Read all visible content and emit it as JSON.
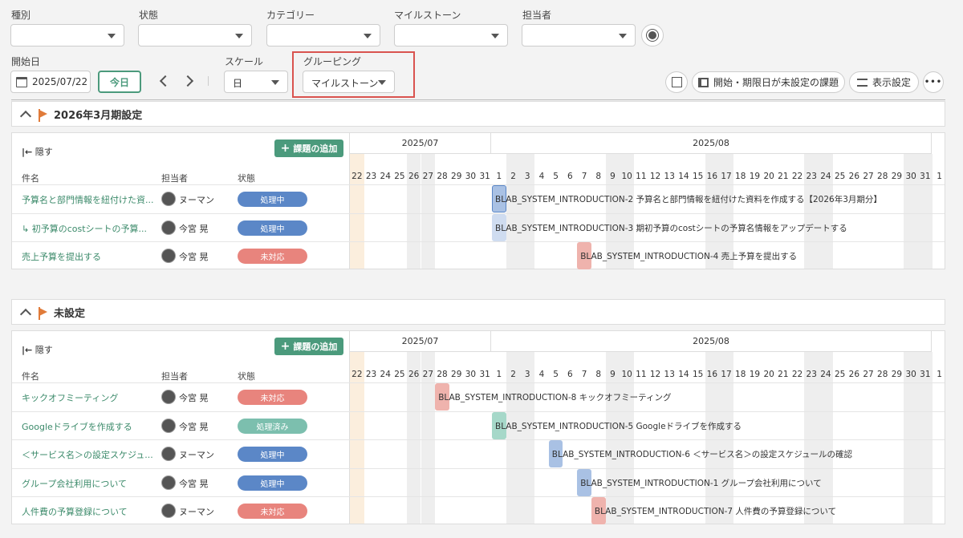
{
  "filters": {
    "type_label": "種別",
    "status_label": "状態",
    "category_label": "カテゴリー",
    "milestone_label": "マイルストーン",
    "assignee_label": "担当者"
  },
  "toolbar": {
    "start_date_label": "開始日",
    "start_date_value": "2025/07/22",
    "today_label": "今日",
    "scale_label": "スケール",
    "scale_value": "日",
    "grouping_label": "グルーピング",
    "grouping_value": "マイルストーン",
    "unset_issues_label": "開始・期限日が未設定の課題",
    "display_settings_label": "表示設定"
  },
  "colors": {
    "accent": "#4b9a7c",
    "status_in_progress": "#5b87c7",
    "status_open": "#e8847d",
    "status_resolved": "#7cbfae",
    "highlight_box": "#d9534f"
  },
  "gantt_header": {
    "month1": "2025/07",
    "month2": "2025/08",
    "days": [
      "22",
      "23",
      "24",
      "25",
      "26",
      "27",
      "28",
      "29",
      "30",
      "31",
      "1",
      "2",
      "3",
      "4",
      "5",
      "6",
      "7",
      "8",
      "9",
      "10",
      "11",
      "12",
      "13",
      "14",
      "15",
      "16",
      "17",
      "18",
      "19",
      "20",
      "21",
      "22",
      "23",
      "24",
      "25",
      "26",
      "27",
      "28",
      "29",
      "30",
      "31",
      "1"
    ]
  },
  "common": {
    "hide_label": "隠す",
    "add_issue_label": "課題の追加",
    "col_name": "件名",
    "col_assignee": "担当者",
    "col_status": "状態"
  },
  "groups": [
    {
      "title": "2026年3月期設定",
      "rows": [
        {
          "name": "予算名と部門情報を紐付けた資...",
          "assignee": "ヌーマン",
          "status": "処理中",
          "bar_text": "BLAB_SYSTEM_INTRODUCTION-2  予算名と部門情報を紐付けた資料を作成する【2026年3月期分】"
        },
        {
          "name": "↳ 初予算のcostシートの予算...",
          "assignee": "今宮 晃",
          "status": "処理中",
          "bar_text": "BLAB_SYSTEM_INTRODUCTION-3  期初予算のcostシートの予算名情報をアップデートする"
        },
        {
          "name": "売上予算を提出する",
          "assignee": "今宮 晃",
          "status": "未対応",
          "bar_text": "BLAB_SYSTEM_INTRODUCTION-4  売上予算を提出する"
        }
      ]
    },
    {
      "title": "未設定",
      "rows": [
        {
          "name": "キックオフミーティング",
          "assignee": "今宮 晃",
          "status": "未対応",
          "bar_text": "BLAB_SYSTEM_INTRODUCTION-8  キックオフミーティング"
        },
        {
          "name": "Googleドライブを作成する",
          "assignee": "今宮 晃",
          "status": "処理済み",
          "bar_text": "BLAB_SYSTEM_INTRODUCTION-5  Googleドライブを作成する"
        },
        {
          "name": "＜サービス名＞の設定スケジュ...",
          "assignee": "ヌーマン",
          "status": "処理中",
          "bar_text": "BLAB_SYSTEM_INTRODUCTION-6  ＜サービス名＞の設定スケジュールの確認"
        },
        {
          "name": "グループ会社利用について",
          "assignee": "今宮 晃",
          "status": "処理中",
          "bar_text": "BLAB_SYSTEM_INTRODUCTION-1  グループ会社利用について"
        },
        {
          "name": "人件費の予算登録について",
          "assignee": "ヌーマン",
          "status": "未対応",
          "bar_text": "BLAB_SYSTEM_INTRODUCTION-7  人件費の予算登録について"
        }
      ]
    }
  ]
}
